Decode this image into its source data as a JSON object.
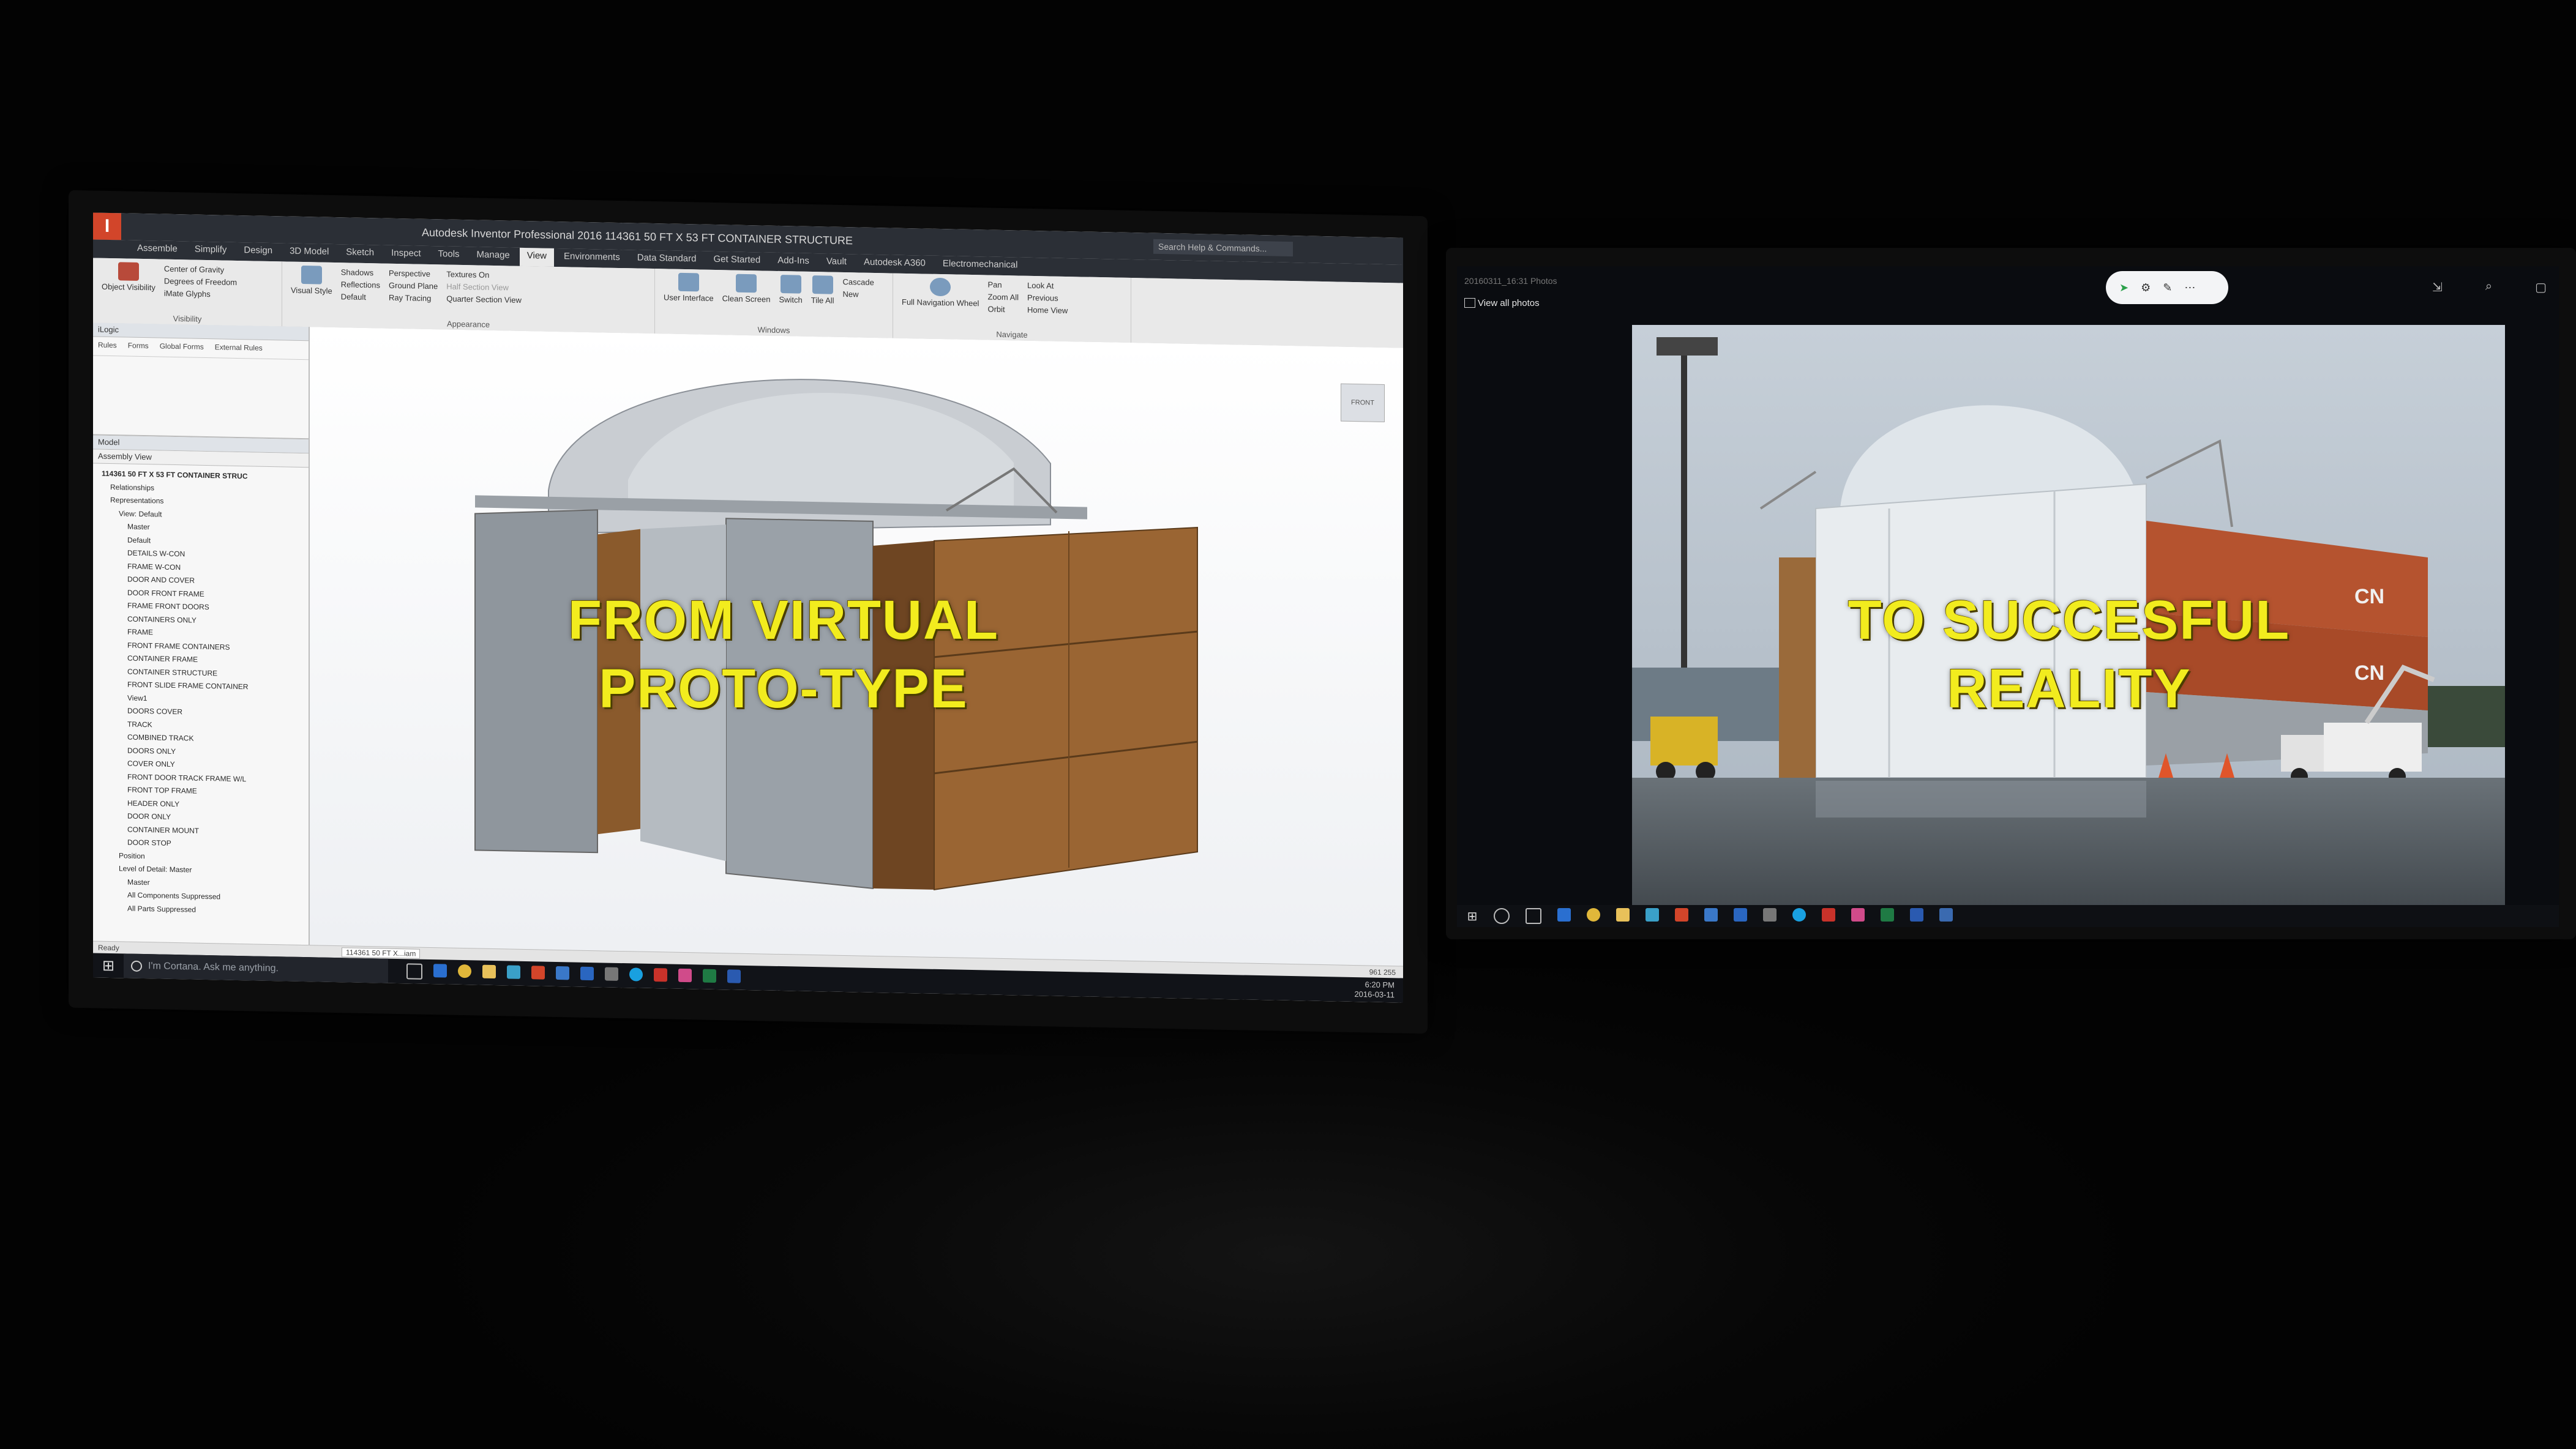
{
  "captions": {
    "left_line1": "FROM VIRTUAL",
    "left_line2": "PROTO-TYPE",
    "right_line1": "TO SUCCESFUL",
    "right_line2": "REALITY"
  },
  "inventor": {
    "app_logo": "I",
    "window_title": "Autodesk Inventor Professional 2016  114361 50 FT X 53 FT CONTAINER STRUCTURE",
    "search_placeholder": "Search Help & Commands...",
    "tabs": [
      "Assemble",
      "Simplify",
      "Design",
      "3D Model",
      "Sketch",
      "Inspect",
      "Tools",
      "Manage",
      "View",
      "Environments",
      "Data Standard",
      "Get Started",
      "Add-Ins",
      "Vault",
      "Autodesk A360",
      "Electromechanical"
    ],
    "active_tab": "View",
    "ribbon": {
      "visibility": {
        "title": "Visibility",
        "object_visibility": "Object Visibility",
        "items": [
          "Center of Gravity",
          "Degrees of Freedom",
          "iMate Glyphs"
        ]
      },
      "appearance": {
        "title": "Appearance",
        "visual_style": "Visual Style",
        "col1": [
          "Shadows",
          "Reflections",
          "Default"
        ],
        "col2": [
          "Perspective",
          "Ground Plane",
          "Ray Tracing"
        ],
        "col3": [
          "Textures On",
          "Half Section View",
          "Quarter Section View"
        ]
      },
      "windows": {
        "title": "Windows",
        "buttons": [
          "User Interface",
          "Clean Screen",
          "Switch",
          "Tile All"
        ],
        "list": [
          "Cascade",
          "New"
        ]
      },
      "navigate": {
        "title": "Navigate",
        "full_nav_wheel": "Full Navigation Wheel",
        "col1": [
          "Pan",
          "Zoom All",
          "Orbit"
        ],
        "col2": [
          "Look At",
          "Previous",
          "Home View"
        ]
      }
    },
    "browser": {
      "panel1_title": "iLogic",
      "panel1_tabs": [
        "Rules",
        "Forms",
        "Global Forms",
        "External Rules"
      ],
      "panel2_title": "Model",
      "view_label": "Assembly View",
      "tree": [
        "114361 50 FT X 53 FT CONTAINER STRUC",
        "Relationships",
        "Representations",
        "View: Default",
        "Master",
        "Default",
        "DETAILS W-CON",
        "FRAME W-CON",
        "DOOR AND COVER",
        "DOOR FRONT FRAME",
        "FRAME FRONT DOORS",
        "CONTAINERS ONLY",
        "FRAME",
        "FRONT FRAME CONTAINERS",
        "CONTAINER FRAME",
        "CONTAINER STRUCTURE",
        "FRONT SLIDE FRAME CONTAINER",
        "View1",
        "DOORS COVER",
        "TRACK",
        "COMBINED TRACK",
        "DOORS ONLY",
        "COVER ONLY",
        "FRONT DOOR TRACK FRAME W/L",
        "FRONT TOP FRAME",
        "HEADER ONLY",
        "DOOR ONLY",
        "CONTAINER MOUNT",
        "DOOR STOP",
        "Position",
        "Level of Detail: Master",
        "Master",
        "All Components Suppressed",
        "All Parts Suppressed"
      ]
    },
    "viewcube_label": "FRONT",
    "doc_tab": "114361 50 FT X...iam",
    "status": "Ready",
    "status_right": "961 255"
  },
  "taskbar_left": {
    "cortana_placeholder": "I'm Cortana. Ask me anything.",
    "time": "6:20 PM",
    "date": "2016-03-11"
  },
  "photos": {
    "window_title": "20160311_16:31 Photos",
    "view_all": "View all photos",
    "container_mark": "CN",
    "nav": {
      "prev": "←",
      "delete": "🗑",
      "next": "→"
    }
  },
  "colors": {
    "caption_yellow": "#f2ec1e",
    "inventor_accent": "#d2452a",
    "cover_white": "#dfe5ea",
    "container_brown": "#8a5a2c",
    "container_red": "#b5532f"
  }
}
